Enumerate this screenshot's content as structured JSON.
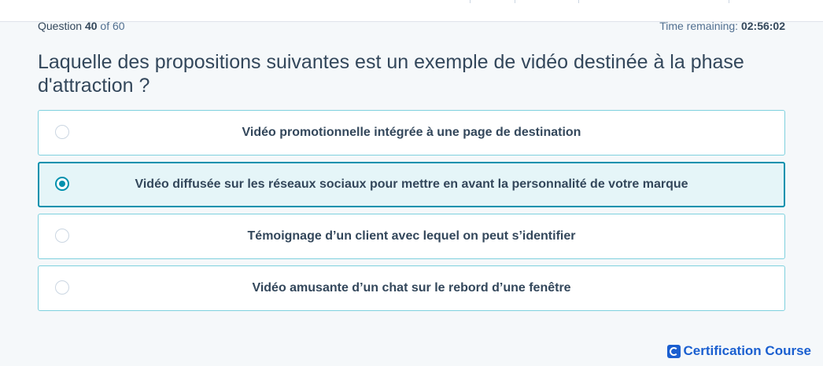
{
  "header": {
    "question_word": "Question",
    "question_number": "40",
    "of_text": "of 60",
    "timer_label": "Time remaining:",
    "timer_value": "02:56:02"
  },
  "question": {
    "text": "Laquelle des propositions suivantes est un exemple de vidéo destinée à la phase d'attraction ?"
  },
  "options": [
    {
      "label": "Vidéo promotionnelle intégrée à une page de destination",
      "selected": false
    },
    {
      "label": "Vidéo diffusée sur les réseaux sociaux pour mettre en avant la personnalité de votre marque",
      "selected": true
    },
    {
      "label": "Témoignage d’un client avec lequel on peut s’identifier",
      "selected": false
    },
    {
      "label": "Vidéo amusante d’un chat sur le rebord d’une fenêtre",
      "selected": false
    }
  ],
  "footer": {
    "brand_icon": "certification-logo-icon",
    "brand_text": "Certification Course"
  },
  "colors": {
    "accent": "#0091ae",
    "selected_bg": "#e5f5f8",
    "option_border": "#7fd1de",
    "text": "#33475b",
    "brand": "#1a5fd0"
  }
}
